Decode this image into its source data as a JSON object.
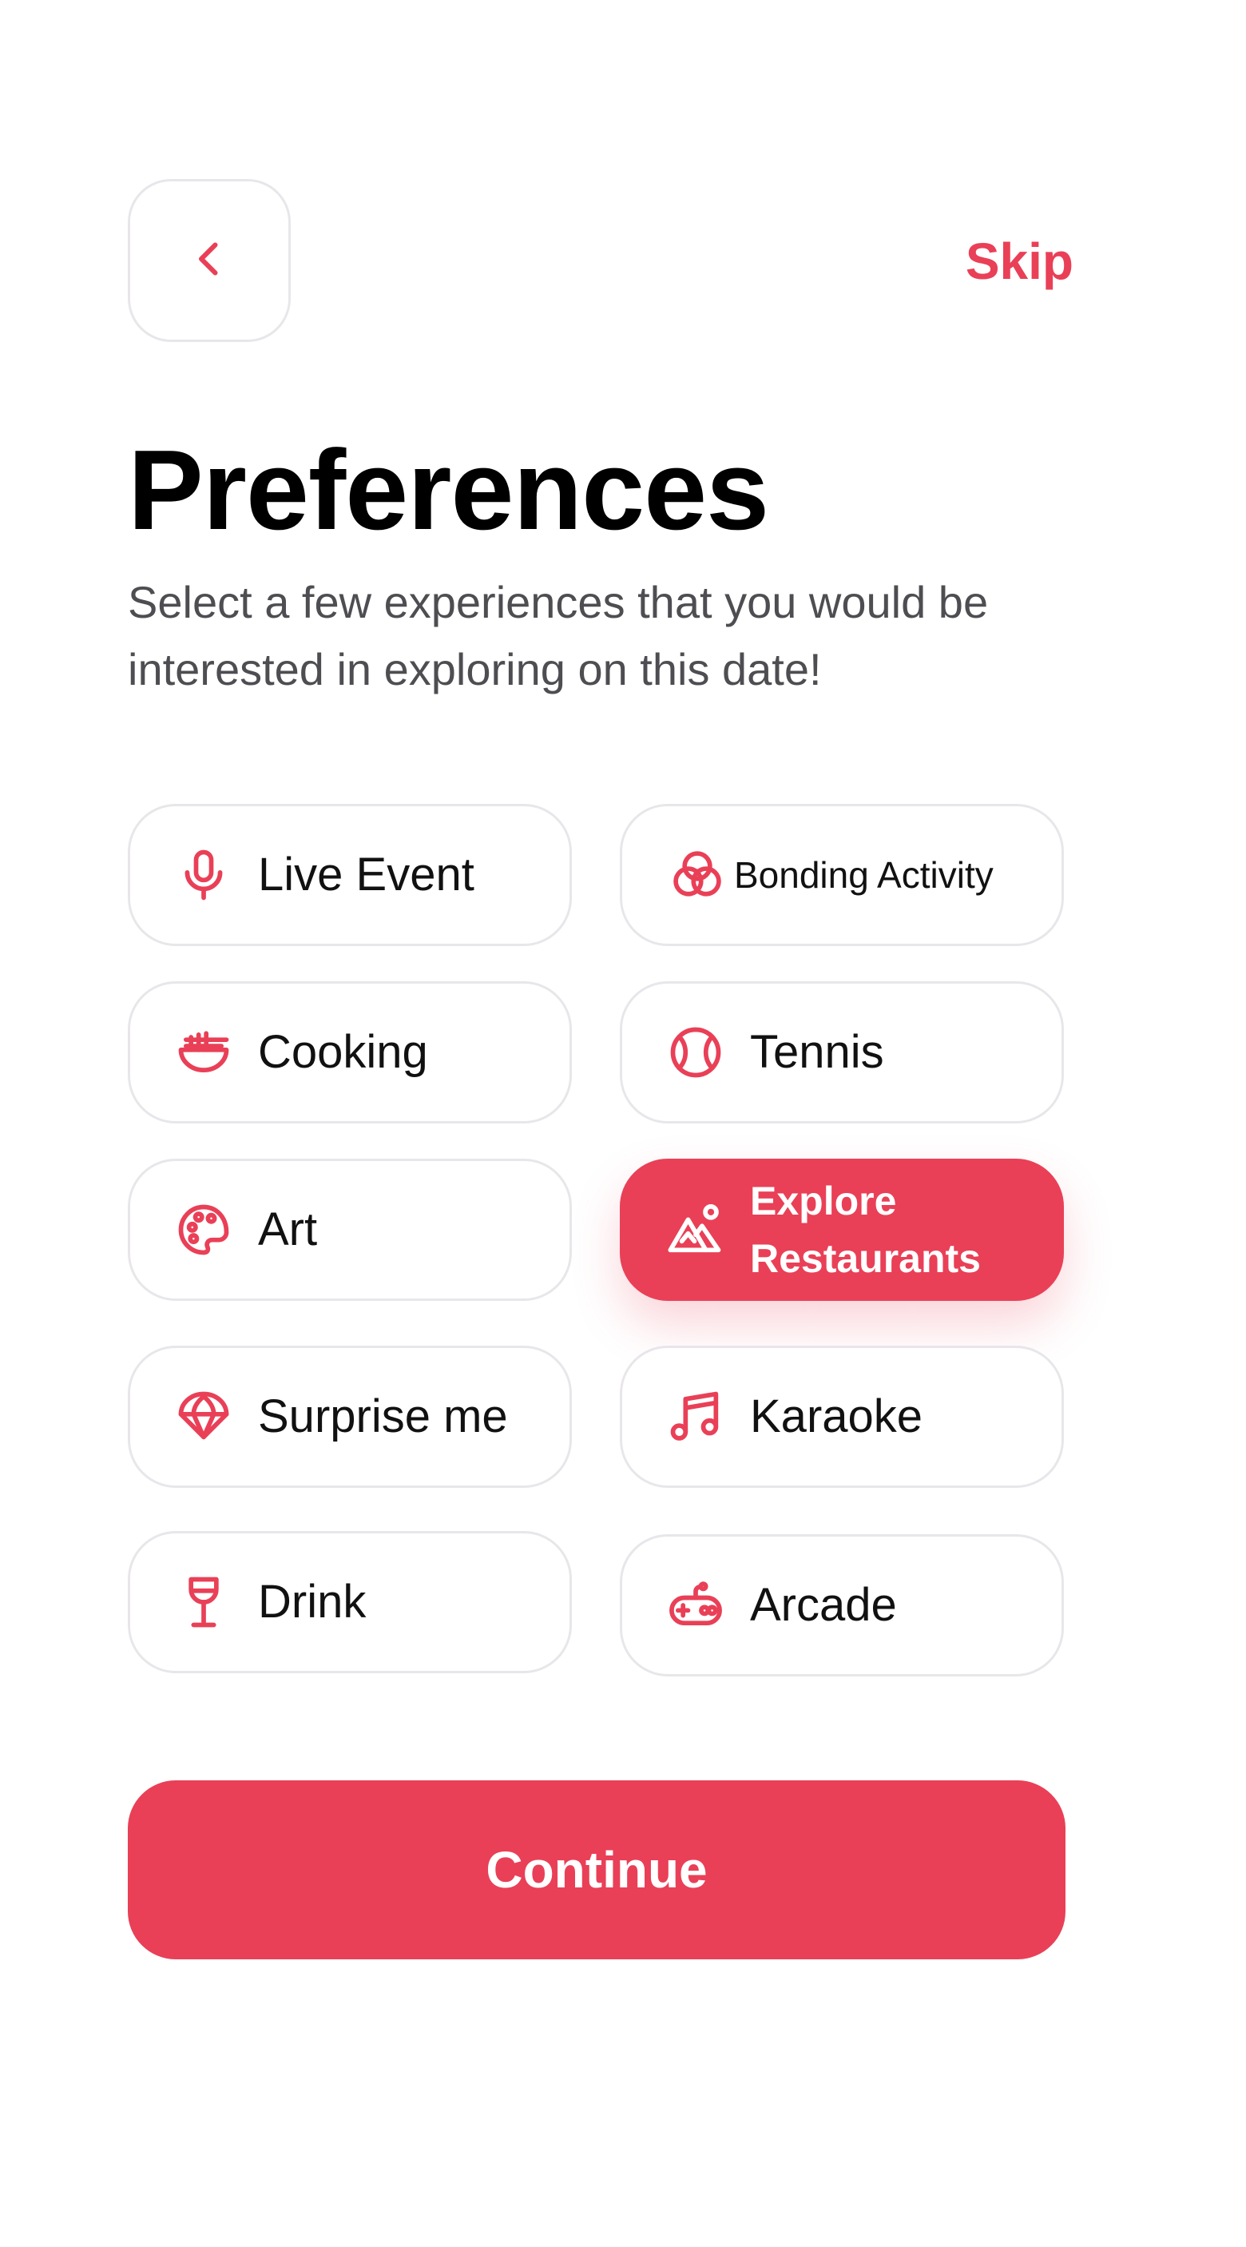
{
  "header": {
    "back_icon": "chevron-left-icon",
    "skip_label": "Skip"
  },
  "title": "Preferences",
  "subtitle": "Select a few experiences that you would be interested in exploring on this date!",
  "accent_color": "#e94057",
  "preferences": [
    {
      "label": "Live Event",
      "icon": "microphone-icon",
      "selected": false
    },
    {
      "label": "Bonding Activity",
      "icon": "interlocking-circles-icon",
      "selected": false
    },
    {
      "label": "Cooking",
      "icon": "noodle-bowl-icon",
      "selected": false
    },
    {
      "label": "Tennis",
      "icon": "tennis-ball-icon",
      "selected": false
    },
    {
      "label": "Art",
      "icon": "palette-icon",
      "selected": false
    },
    {
      "label": "Explore Restaurants",
      "icon": "mountain-landscape-icon",
      "selected": true
    },
    {
      "label": "Surprise me",
      "icon": "parachute-icon",
      "selected": false
    },
    {
      "label": "Karaoke",
      "icon": "music-note-icon",
      "selected": false
    },
    {
      "label": "Drink",
      "icon": "wine-glass-icon",
      "selected": false
    },
    {
      "label": "Arcade",
      "icon": "gamepad-icon",
      "selected": false
    }
  ],
  "continue_label": "Continue"
}
